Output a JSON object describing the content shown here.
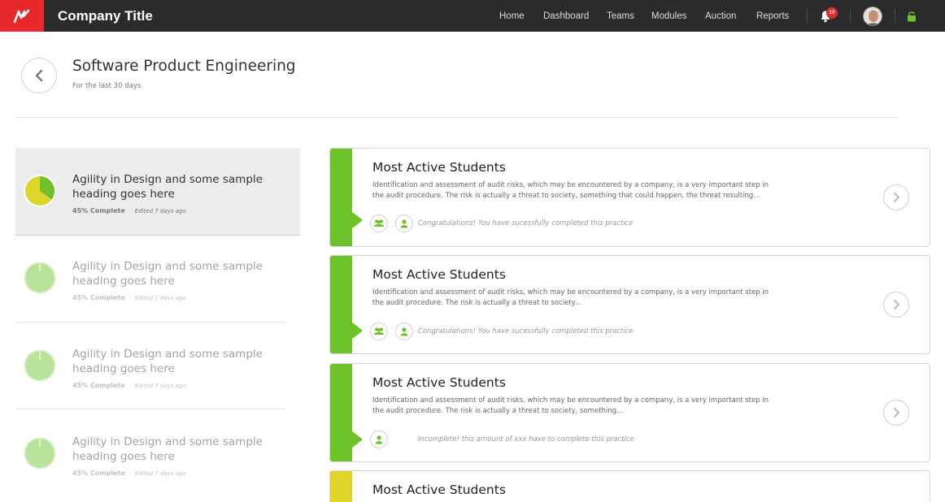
{
  "app": {
    "brand": "Company Title",
    "logo_icon": "brand-logo-icon",
    "accent": "#e8282b"
  },
  "nav": {
    "items": [
      "Home",
      "Dashboard",
      "Teams",
      "Modules",
      "Auction",
      "Reports"
    ],
    "notifications_count": "10"
  },
  "header": {
    "title": "Software Product Engineering",
    "subtitle": "For the last 30 days"
  },
  "modules": [
    {
      "title": "Agility in Design and some sample heading goes here",
      "progress_label": "45% Complete",
      "progress": 0.45,
      "edited": "Edited 7 days ago",
      "active": true
    },
    {
      "title": "Agility in Design and some sample heading goes here",
      "progress_label": "45% Complete",
      "progress": 0.45,
      "edited": "Edited 7 days ago",
      "active": false
    },
    {
      "title": "Agility in Design and some sample heading goes here",
      "progress_label": "45% Complete",
      "progress": 0.45,
      "edited": "Edited 7 days ago",
      "active": false
    },
    {
      "title": "Agility in Design and some sample heading goes here",
      "progress_label": "45% Complete",
      "progress": 0.45,
      "edited": "Edited 7 days ago",
      "active": false
    }
  ],
  "cards": [
    {
      "title": "Most Active Students",
      "description": "Identification and assessment of audit risks, which may be encountered by a company, is a very important step in the audit procedure. The risk is actually a threat to society, something that could happen, the threat resulting...",
      "status": "Congratulations! You have sucessfully completed this practice",
      "strip_color": "#6ec22a"
    },
    {
      "title": "Most Active Students",
      "description": "Identification and assessment of audit risks, which may be encountered by a company, is a very important step in the audit procedure. The risk is actually a threat to society...",
      "status": "Congratulations! You have sucessfully completed this practice",
      "strip_color": "#6ec22a"
    },
    {
      "title": "Most Active Students",
      "description": "Identification and assessment of audit risks, which may be encountered by a company, is a very important step in the audit procedure. The risk is actually a threat to society, something...",
      "status": "Incomplete! this amount of xxx have to complete this practice",
      "strip_color": "#6ec22a"
    },
    {
      "title": "Most Active Students",
      "strip_color": "#e2d02a"
    }
  ],
  "colors": {
    "green": "#6ec22a",
    "yellow": "#dfd52a",
    "pie_light": "#b9e39a"
  }
}
